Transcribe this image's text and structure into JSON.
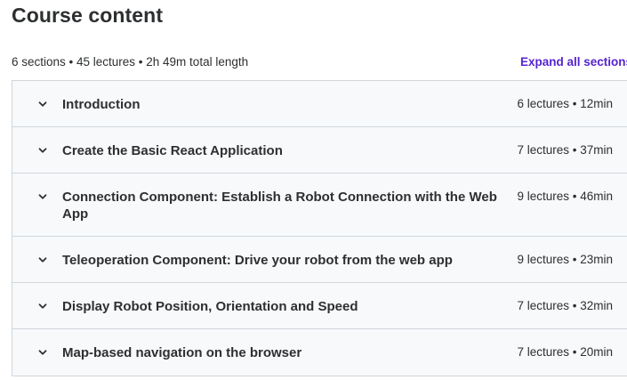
{
  "header": {
    "title": "Course content",
    "summary": "6 sections • 45 lectures • 2h 49m total length",
    "expand_all_label": "Expand all sections"
  },
  "sections": [
    {
      "title": "Introduction",
      "meta": "6 lectures • 12min"
    },
    {
      "title": "Create the Basic React Application",
      "meta": "7 lectures • 37min"
    },
    {
      "title": "Connection Component: Establish a Robot Connection with the Web App",
      "meta": "9 lectures • 46min"
    },
    {
      "title": "Teleoperation Component: Drive your robot from the web app",
      "meta": "9 lectures • 23min"
    },
    {
      "title": "Display Robot Position, Orientation and Speed",
      "meta": "7 lectures • 32min"
    },
    {
      "title": "Map-based navigation on the browser",
      "meta": "7 lectures • 20min"
    }
  ],
  "icons": {
    "chevron": "chevron-down-icon"
  },
  "colors": {
    "accent": "#5624d0",
    "text": "#2d2f31",
    "section_bg": "#f7f9fa",
    "border": "#d1d7dc"
  }
}
